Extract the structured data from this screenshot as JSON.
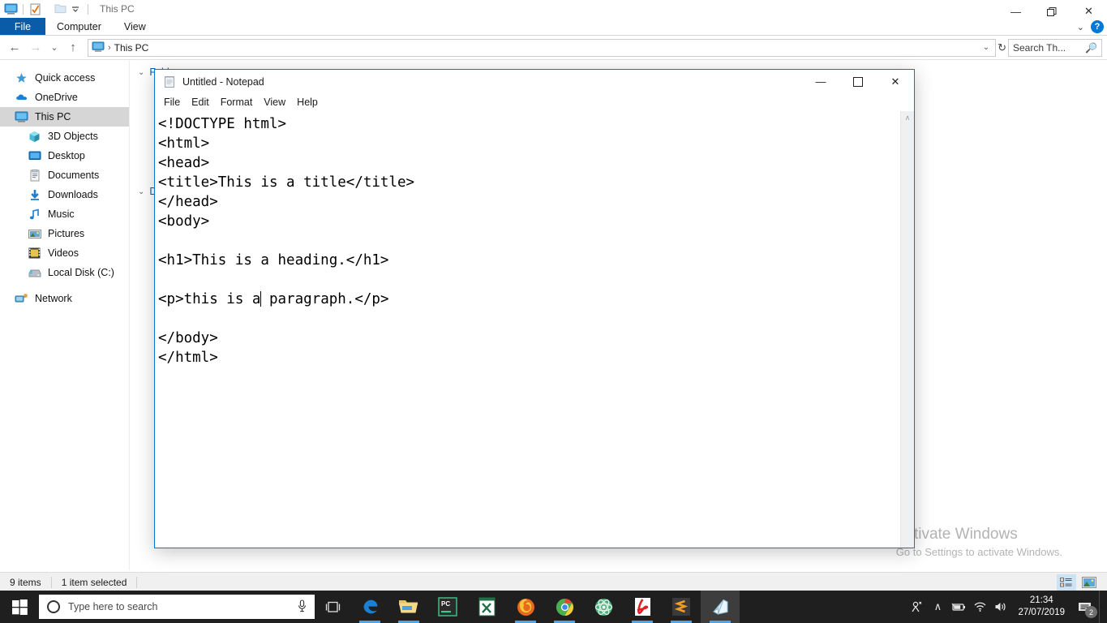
{
  "explorer": {
    "title": "This PC",
    "quick_access_icons": [
      "this-pc-icon",
      "properties-icon",
      "new-folder-icon",
      "customize-dropdown-icon"
    ],
    "window_buttons": {
      "minimize": "—",
      "restore": "❐",
      "close": "✕"
    },
    "ribbon_tabs": [
      {
        "label": "File",
        "active": true
      },
      {
        "label": "Computer",
        "active": false
      },
      {
        "label": "View",
        "active": false
      }
    ],
    "ribbon_collapse_icon": "chevron-down-icon",
    "help_label": "?",
    "address": {
      "back_icon": "←",
      "forward_icon": "→",
      "recent_icon": "⌄",
      "up_icon": "↑",
      "breadcrumb_icon": "this-pc-icon",
      "breadcrumb_separator": "›",
      "breadcrumb_text": "This PC",
      "dropdown_icon": "⌄",
      "refresh_icon": "↻"
    },
    "search": {
      "placeholder": "Search Th...",
      "icon": "search-icon"
    },
    "nav_items": [
      {
        "label": "Quick access",
        "icon": "star-icon",
        "indent": false,
        "state": "normal"
      },
      {
        "label": "OneDrive",
        "icon": "cloud-icon",
        "indent": false,
        "state": "normal"
      },
      {
        "label": "This PC",
        "icon": "this-pc-icon",
        "indent": false,
        "state": "selected"
      },
      {
        "label": "3D Objects",
        "icon": "3d-objects-icon",
        "indent": true,
        "state": "normal"
      },
      {
        "label": "Desktop",
        "icon": "desktop-icon",
        "indent": true,
        "state": "normal"
      },
      {
        "label": "Documents",
        "icon": "documents-icon",
        "indent": true,
        "state": "normal"
      },
      {
        "label": "Downloads",
        "icon": "downloads-icon",
        "indent": true,
        "state": "normal"
      },
      {
        "label": "Music",
        "icon": "music-icon",
        "indent": true,
        "state": "normal"
      },
      {
        "label": "Pictures",
        "icon": "pictures-icon",
        "indent": true,
        "state": "normal"
      },
      {
        "label": "Videos",
        "icon": "videos-icon",
        "indent": true,
        "state": "normal"
      },
      {
        "label": "Local Disk (C:)",
        "icon": "disk-icon",
        "indent": true,
        "state": "normal"
      },
      {
        "label": "Network",
        "icon": "network-icon",
        "indent": false,
        "state": "normal"
      }
    ],
    "groups": [
      {
        "label": "Folders",
        "chevron": "⌄"
      },
      {
        "label": "Devices and drives",
        "chevron": "⌄"
      }
    ],
    "status": {
      "items": "9 items",
      "selection": "1 item selected"
    },
    "view_buttons": [
      {
        "name": "details-view-button",
        "active": true
      },
      {
        "name": "large-icons-view-button",
        "active": false
      }
    ]
  },
  "notepad": {
    "title": "Untitled - Notepad",
    "icon": "notepad-icon",
    "menus": [
      "File",
      "Edit",
      "Format",
      "View",
      "Help"
    ],
    "window_buttons": {
      "minimize": "—",
      "maximize": "☐",
      "close": "✕"
    },
    "scrollbar_up_icon": "∧",
    "content_before_caret": "<!DOCTYPE html>\n<html>\n<head>\n<title>This is a title</title>\n</head>\n<body>\n\n<h1>This is a heading.</h1>\n\n<p>this is a",
    "content_after_caret": " paragraph.</p>\n\n</body>\n</html>"
  },
  "watermark": {
    "line1": "Activate Windows",
    "line2": "Go to Settings to activate Windows."
  },
  "taskbar": {
    "start_icon": "windows-logo-icon",
    "search": {
      "placeholder": "Type here to search",
      "icon": "search-ring-icon",
      "mic_icon": "ƪ"
    },
    "task_view_icon": "task-view-icon",
    "apps": [
      {
        "name": "edge",
        "running": true
      },
      {
        "name": "file-explorer",
        "running": true
      },
      {
        "name": "pycharm",
        "running": false
      },
      {
        "name": "excel",
        "running": false
      },
      {
        "name": "firefox",
        "running": true
      },
      {
        "name": "chrome",
        "running": true
      },
      {
        "name": "atom",
        "running": false
      },
      {
        "name": "adobe-reader",
        "running": true
      },
      {
        "name": "sublime-text",
        "running": true
      },
      {
        "name": "notepad",
        "running": true,
        "active": true
      }
    ],
    "tray": {
      "people_icon": "⚇",
      "chevron_icon": "∧",
      "battery_icon": "battery-icon",
      "wifi_icon": "wifi-icon",
      "volume_icon": "volume-icon",
      "time": "21:34",
      "date": "27/07/2019",
      "notification_count": "2"
    }
  },
  "colors": {
    "accent": "#0078d7",
    "ribbon_file": "#0a5ca8",
    "taskbar": "#1f1f1f",
    "selection": "#cde8ff"
  }
}
